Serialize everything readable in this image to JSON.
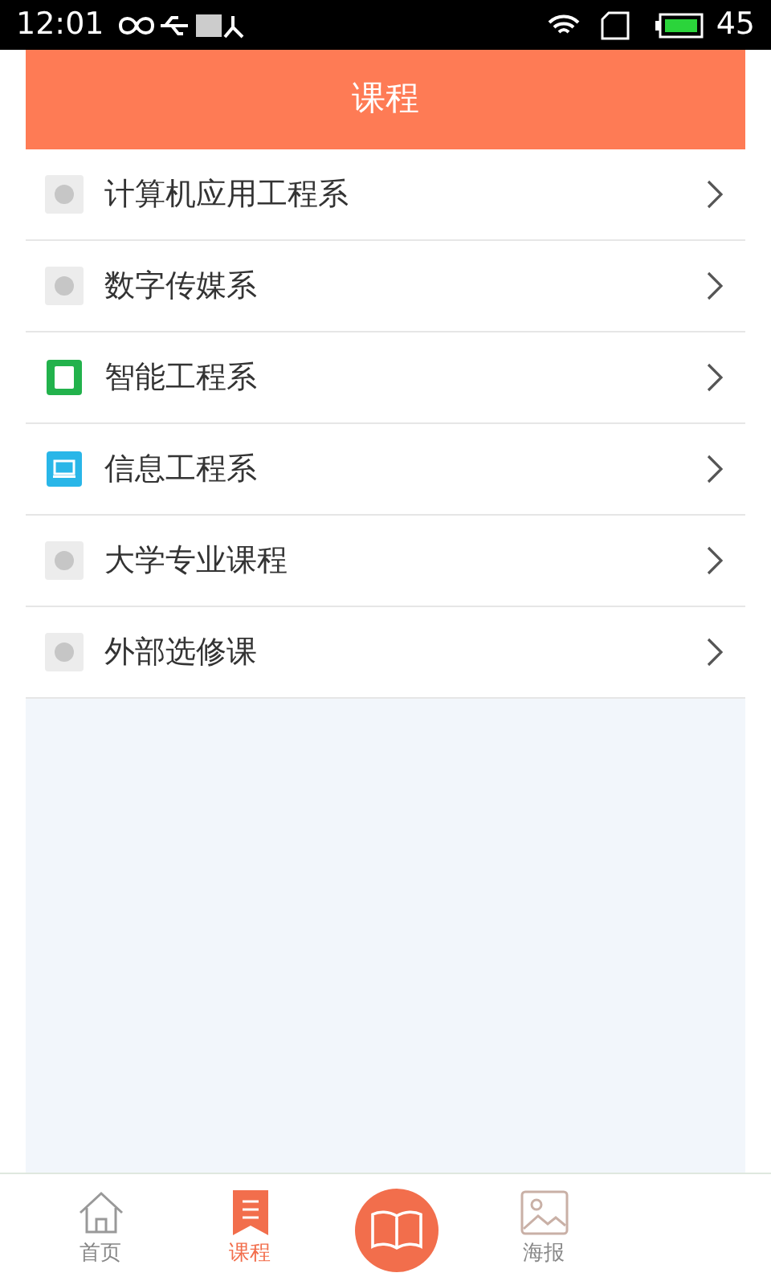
{
  "status_bar": {
    "time": "12:01",
    "battery": "45"
  },
  "header": {
    "title": "课程"
  },
  "items": [
    {
      "label": "计算机应用工程系",
      "kind": "placeholder"
    },
    {
      "label": "数字传媒系",
      "kind": "placeholder"
    },
    {
      "label": "智能工程系",
      "kind": "book"
    },
    {
      "label": "信息工程系",
      "kind": "laptop"
    },
    {
      "label": "大学专业课程",
      "kind": "placeholder"
    },
    {
      "label": "外部选修课",
      "kind": "placeholder"
    }
  ],
  "tab_bar": [
    {
      "kind": "tab",
      "label": "首页",
      "selected": false
    },
    {
      "kind": "tab",
      "label": "课程",
      "selected": true
    },
    {
      "kind": "center"
    },
    {
      "kind": "tab",
      "label": "海报",
      "selected": false
    }
  ]
}
